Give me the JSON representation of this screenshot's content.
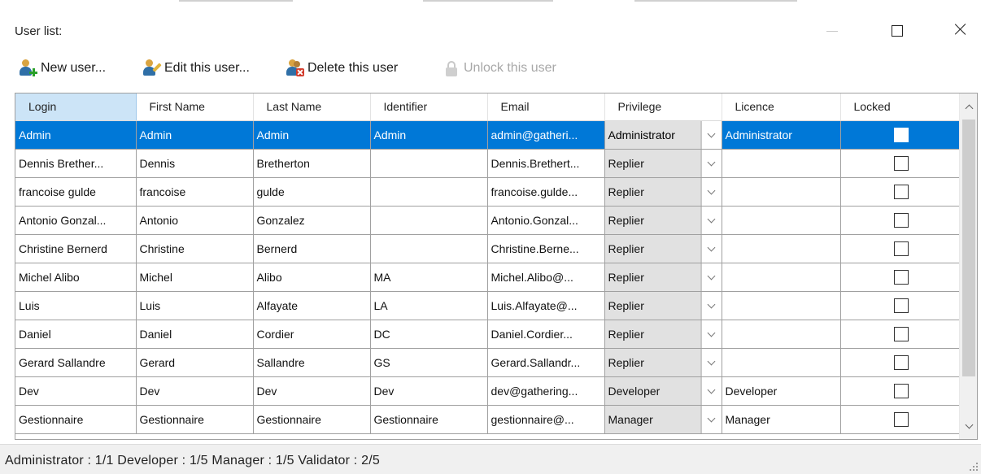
{
  "window": {
    "title": "User list:"
  },
  "toolbar": {
    "new_user": "New user...",
    "edit_user": "Edit this user...",
    "delete_user": "Delete this user",
    "unlock_user": "Unlock this user"
  },
  "grid": {
    "columns": [
      "Login",
      "First Name",
      "Last Name",
      "Identifier",
      "Email",
      "Privilege",
      "Licence",
      "Locked"
    ],
    "rows": [
      {
        "login": "Admin",
        "first": "Admin",
        "last": "Admin",
        "identifier": "Admin",
        "email": "admin@gatheri...",
        "privilege": "Administrator",
        "licence": "Administrator",
        "locked": false,
        "selected": true
      },
      {
        "login": "Dennis Brether...",
        "first": "Dennis",
        "last": "Bretherton",
        "identifier": "",
        "email": "Dennis.Brethert...",
        "privilege": "Replier",
        "licence": "",
        "locked": false,
        "selected": false
      },
      {
        "login": "francoise gulde",
        "first": "francoise",
        "last": "gulde",
        "identifier": "",
        "email": "francoise.gulde...",
        "privilege": "Replier",
        "licence": "",
        "locked": false,
        "selected": false
      },
      {
        "login": "Antonio Gonzal...",
        "first": "Antonio",
        "last": "Gonzalez",
        "identifier": "",
        "email": "Antonio.Gonzal...",
        "privilege": "Replier",
        "licence": "",
        "locked": false,
        "selected": false
      },
      {
        "login": "Christine Bernerd",
        "first": "Christine",
        "last": "Bernerd",
        "identifier": "",
        "email": "Christine.Berne...",
        "privilege": "Replier",
        "licence": "",
        "locked": false,
        "selected": false
      },
      {
        "login": "Michel Alibo",
        "first": "Michel",
        "last": "Alibo",
        "identifier": "MA",
        "email": "Michel.Alibo@...",
        "privilege": "Replier",
        "licence": "",
        "locked": false,
        "selected": false
      },
      {
        "login": "Luis",
        "first": "Luis",
        "last": "Alfayate",
        "identifier": "LA",
        "email": "Luis.Alfayate@...",
        "privilege": "Replier",
        "licence": "",
        "locked": false,
        "selected": false
      },
      {
        "login": "Daniel",
        "first": "Daniel",
        "last": "Cordier",
        "identifier": "DC",
        "email": "Daniel.Cordier...",
        "privilege": "Replier",
        "licence": "",
        "locked": false,
        "selected": false
      },
      {
        "login": "Gerard Sallandre",
        "first": "Gerard",
        "last": "Sallandre",
        "identifier": "GS",
        "email": "Gerard.Sallandr...",
        "privilege": "Replier",
        "licence": "",
        "locked": false,
        "selected": false
      },
      {
        "login": "Dev",
        "first": "Dev",
        "last": "Dev",
        "identifier": "Dev",
        "email": "dev@gathering...",
        "privilege": "Developer",
        "licence": "Developer",
        "locked": false,
        "selected": false
      },
      {
        "login": "Gestionnaire",
        "first": "Gestionnaire",
        "last": "Gestionnaire",
        "identifier": "Gestionnaire",
        "email": "gestionnaire@...",
        "privilege": "Manager",
        "licence": "Manager",
        "locked": false,
        "selected": false
      }
    ]
  },
  "status": {
    "text": "Administrator : 1/1   Developer : 1/5   Manager : 1/5   Validator : 2/5"
  },
  "colors": {
    "selection": "#0078d7",
    "header_selected": "#cce4f7",
    "combo_bg": "#e1e1e1",
    "status_bg": "#f0f0f0"
  }
}
